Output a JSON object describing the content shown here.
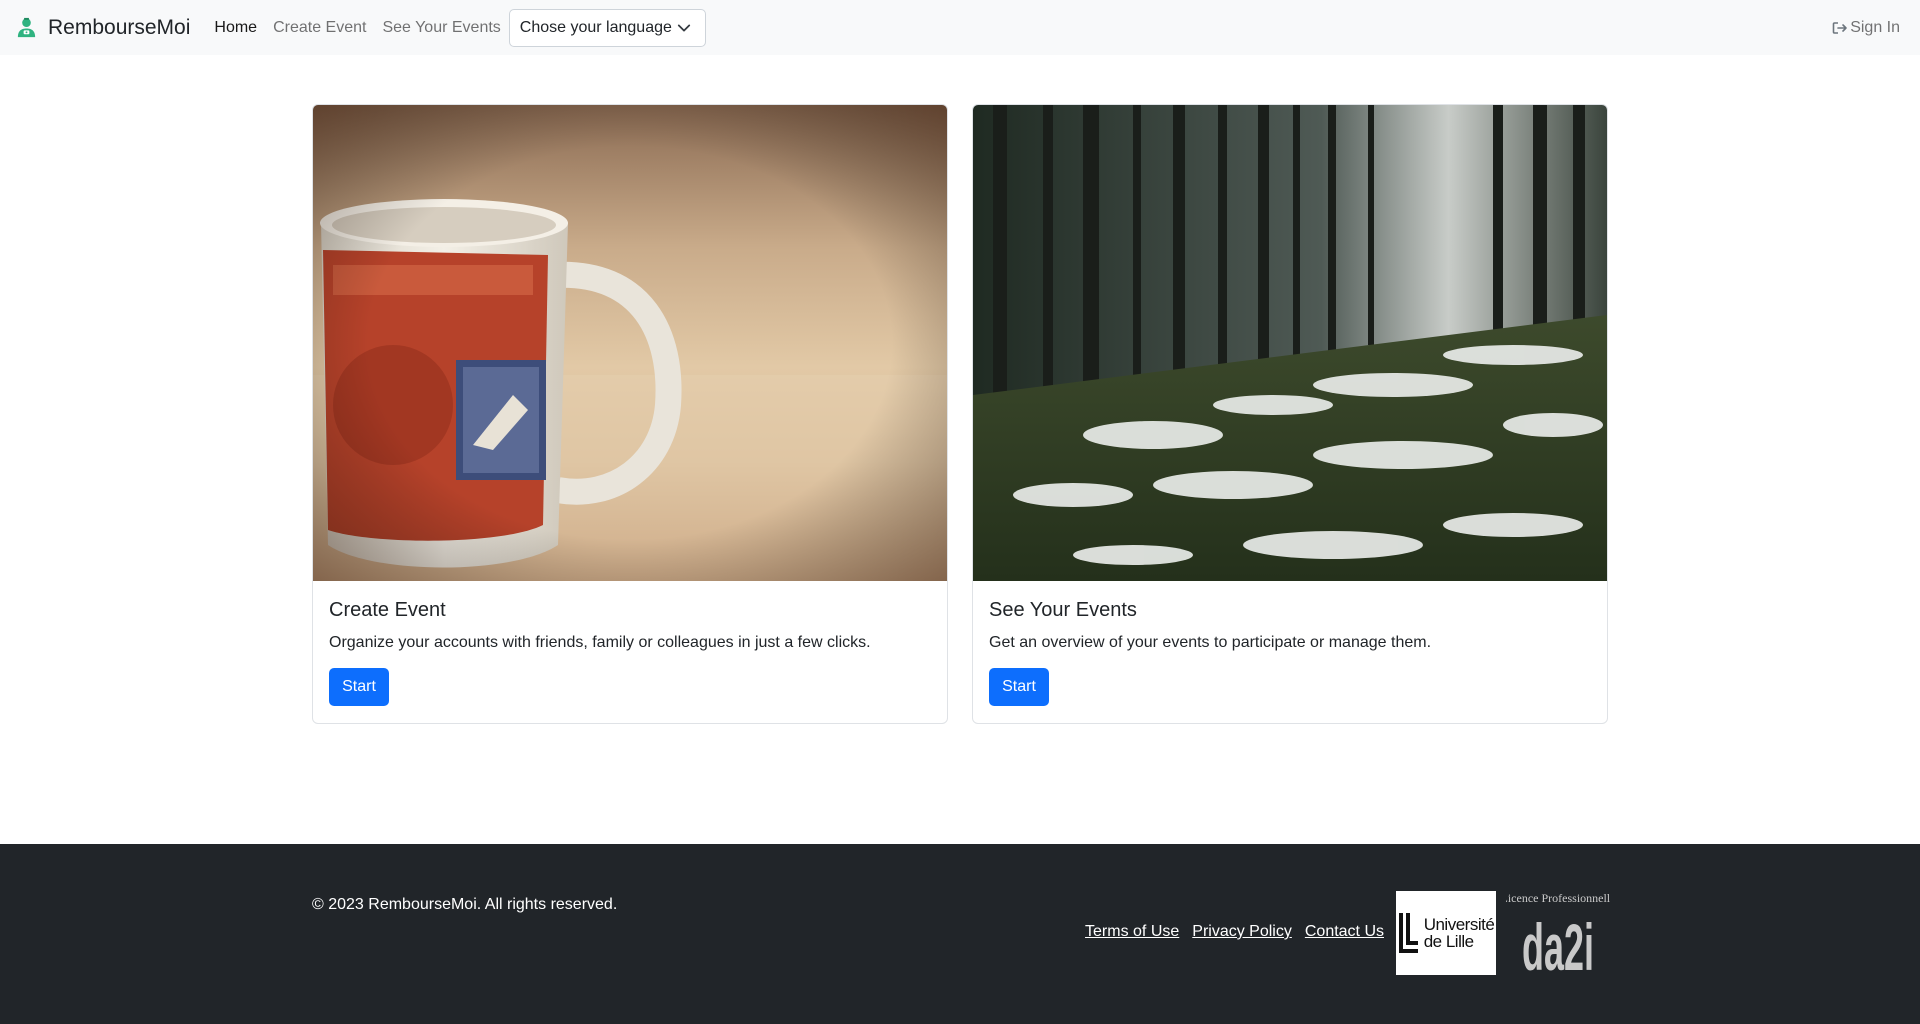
{
  "navbar": {
    "brand": "RembourseMoi",
    "links": [
      "Home",
      "Create Event",
      "See Your Events"
    ],
    "language_select": "Chose your language",
    "signin": "Sign In"
  },
  "cards": [
    {
      "title": "Create Event",
      "text": "Organize your accounts with friends, family or colleagues in just a few clicks.",
      "button": "Start"
    },
    {
      "title": "See Your Events",
      "text": "Get an overview of your events to participate or manage them.",
      "button": "Start"
    }
  ],
  "footer": {
    "copyright": "© 2023 RembourseMoi. All rights reserved.",
    "links": [
      "Terms of Use",
      "Privacy Policy",
      "Contact Us"
    ],
    "logo_lille": "Université de Lille",
    "logo_da2i_top": "Licence Professionnelle",
    "logo_da2i": "da2i"
  },
  "icons": {
    "brand": "money-person-icon",
    "language": "chevron-down-icon",
    "signin": "sign-in-icon"
  },
  "colors": {
    "primary": "#0d6efd",
    "navbar_bg": "#f8f9fa",
    "footer_bg": "#212529",
    "brand_icon": "#2fb380"
  }
}
